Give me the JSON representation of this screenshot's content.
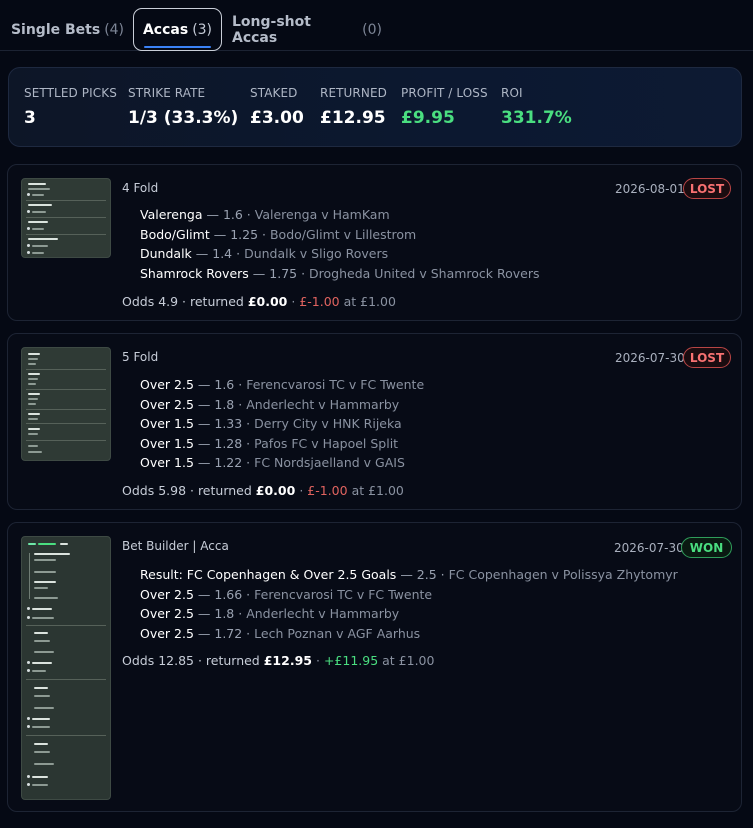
{
  "tabs": [
    {
      "label": "Single Bets",
      "count": "(4)"
    },
    {
      "label": "Accas",
      "count": "(3)"
    },
    {
      "label": "Long-shot Accas",
      "count": "(0)"
    }
  ],
  "stats": {
    "settled_label": "SETTLED PICKS",
    "settled_value": "3",
    "strike_label": "STRIKE RATE",
    "strike_value": "1/3 (33.3%)",
    "staked_label": "STAKED",
    "staked_value": "£3.00",
    "returned_label": "RETURNED",
    "returned_value": "£12.95",
    "pl_label": "PROFIT / LOSS",
    "pl_value": "£9.95",
    "roi_label": "ROI",
    "roi_value": "331.7%"
  },
  "bets": [
    {
      "title": "4 Fold",
      "date": "2026-08-01",
      "status": "LOST",
      "legs": [
        {
          "pick": "Valerenga",
          "odds": "— 1.6 ·",
          "match": "Valerenga v HamKam"
        },
        {
          "pick": "Bodo/Glimt",
          "odds": "— 1.25 ·",
          "match": "Bodo/Glimt v Lillestrom"
        },
        {
          "pick": "Dundalk",
          "odds": "— 1.4 ·",
          "match": "Dundalk v Sligo Rovers"
        },
        {
          "pick": "Shamrock Rovers",
          "odds": "— 1.75 ·",
          "match": "Drogheda United v Shamrock Rovers"
        }
      ],
      "summary": {
        "odds_text": "Odds 4.9 · returned",
        "returned": "£0.00",
        "sep": "·",
        "pl": "£-1.00",
        "stake_text": "at £1.00"
      }
    },
    {
      "title": "5 Fold",
      "date": "2026-07-30",
      "status": "LOST",
      "legs": [
        {
          "pick": "Over 2.5",
          "odds": "— 1.6 ·",
          "match": "Ferencvarosi TC v FC Twente"
        },
        {
          "pick": "Over 2.5",
          "odds": "— 1.8 ·",
          "match": "Anderlecht v Hammarby"
        },
        {
          "pick": "Over 1.5",
          "odds": "— 1.33 ·",
          "match": "Derry City v HNK Rijeka"
        },
        {
          "pick": "Over 1.5",
          "odds": "— 1.28 ·",
          "match": "Pafos FC v Hapoel Split"
        },
        {
          "pick": "Over 1.5",
          "odds": "— 1.22 ·",
          "match": "FC Nordsjaelland v GAIS"
        }
      ],
      "summary": {
        "odds_text": "Odds 5.98 · returned",
        "returned": "£0.00",
        "sep": "·",
        "pl": "£-1.00",
        "stake_text": "at £1.00"
      }
    },
    {
      "title": "Bet Builder | Acca",
      "date": "2026-07-30",
      "status": "WON",
      "legs": [
        {
          "pick": "Result: FC Copenhagen & Over 2.5 Goals",
          "odds": "— 2.5 ·",
          "match": "FC Copenhagen v Polissya Zhytomyr"
        },
        {
          "pick": "Over 2.5",
          "odds": "— 1.66 ·",
          "match": "Ferencvarosi TC v FC Twente"
        },
        {
          "pick": "Over 2.5",
          "odds": "— 1.8 ·",
          "match": "Anderlecht v Hammarby"
        },
        {
          "pick": "Over 2.5",
          "odds": "— 1.72 ·",
          "match": "Lech Poznan v AGF Aarhus"
        }
      ],
      "summary": {
        "odds_text": "Odds 12.85 · returned",
        "returned": "£12.95",
        "sep": "·",
        "pl": "+£11.95",
        "stake_text": "at £1.00"
      }
    }
  ]
}
